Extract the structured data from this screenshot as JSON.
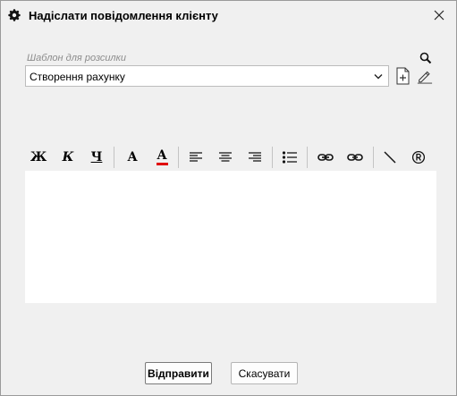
{
  "window": {
    "title": "Надіслати повідомлення клієнту",
    "title_icon": "gear-icon",
    "close_icon": "close-icon"
  },
  "template": {
    "label": "Шаблон для розсилки",
    "selected": "Створення рахунку",
    "search_icon": "search-icon",
    "add_icon": "new-document-icon",
    "edit_icon": "pencil-icon"
  },
  "toolbar": {
    "bold": "Ж",
    "italic": "К",
    "underline": "Ч",
    "font": "A",
    "font_color": "A",
    "accent_color": "#e00000"
  },
  "editor": {
    "content": ""
  },
  "buttons": {
    "send": "Відправити",
    "cancel": "Скасувати"
  }
}
